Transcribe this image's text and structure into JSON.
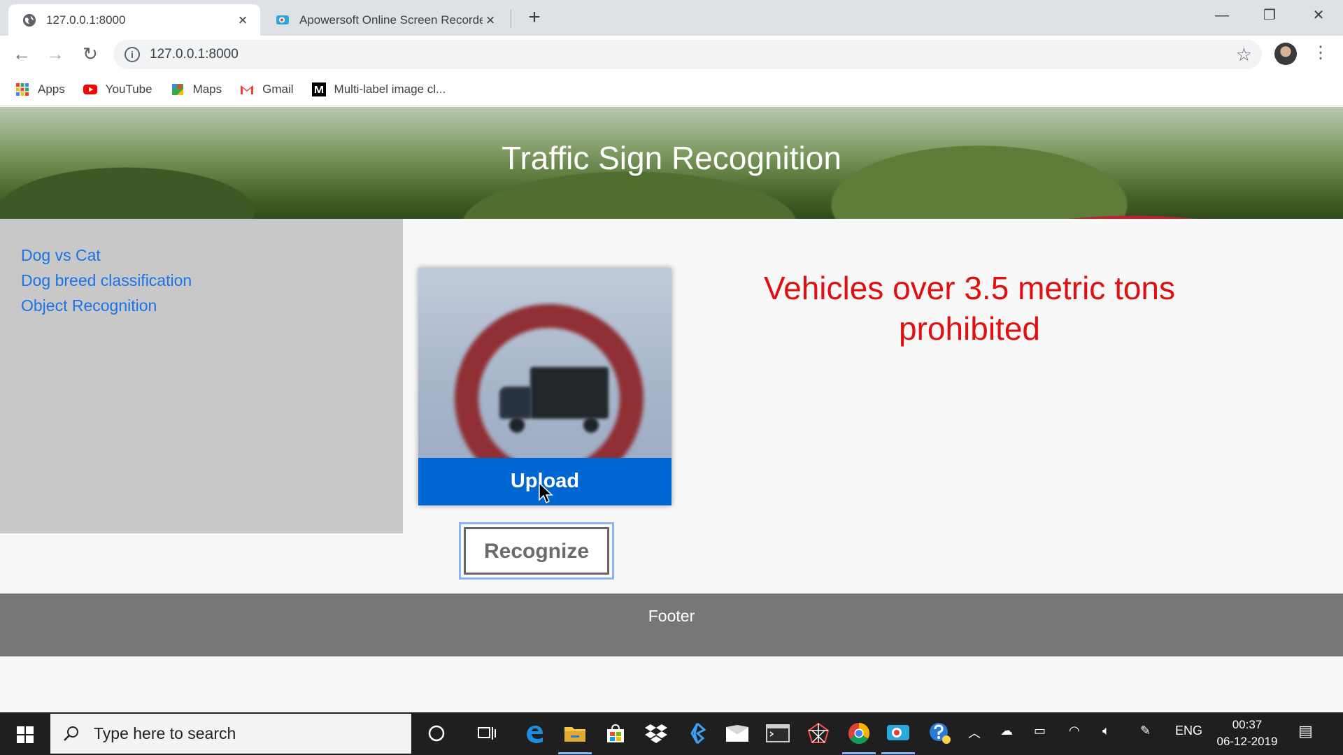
{
  "browser": {
    "tabs": [
      {
        "title": "127.0.0.1:8000",
        "active": true
      },
      {
        "title": "Apowersoft Online Screen Recorder",
        "active": false
      }
    ],
    "address": "127.0.0.1:8000",
    "bookmarks": [
      {
        "label": "Apps",
        "icon": "apps-grid-icon"
      },
      {
        "label": "YouTube",
        "icon": "youtube-icon"
      },
      {
        "label": "Maps",
        "icon": "maps-icon"
      },
      {
        "label": "Gmail",
        "icon": "gmail-icon"
      },
      {
        "label": "Multi-label image cl...",
        "icon": "medium-icon"
      }
    ]
  },
  "page": {
    "title": "Traffic Sign Recognition",
    "sidebar_links": [
      "Dog vs Cat",
      "Dog breed classification",
      "Object Recognition"
    ],
    "upload_label": "Upload",
    "recognize_label": "Recognize",
    "result": "Vehicles over 3.5 metric tons prohibited",
    "footer": "Footer"
  },
  "taskbar": {
    "search_placeholder": "Type here to search",
    "language": "ENG",
    "time": "00:37",
    "date": "06-12-2019"
  },
  "colors": {
    "link": "#1a73e8",
    "upload_bg": "#0066d2",
    "result_text": "#e01010",
    "sidebar_bg": "#c8c8c8",
    "footer_bg": "#777777"
  }
}
